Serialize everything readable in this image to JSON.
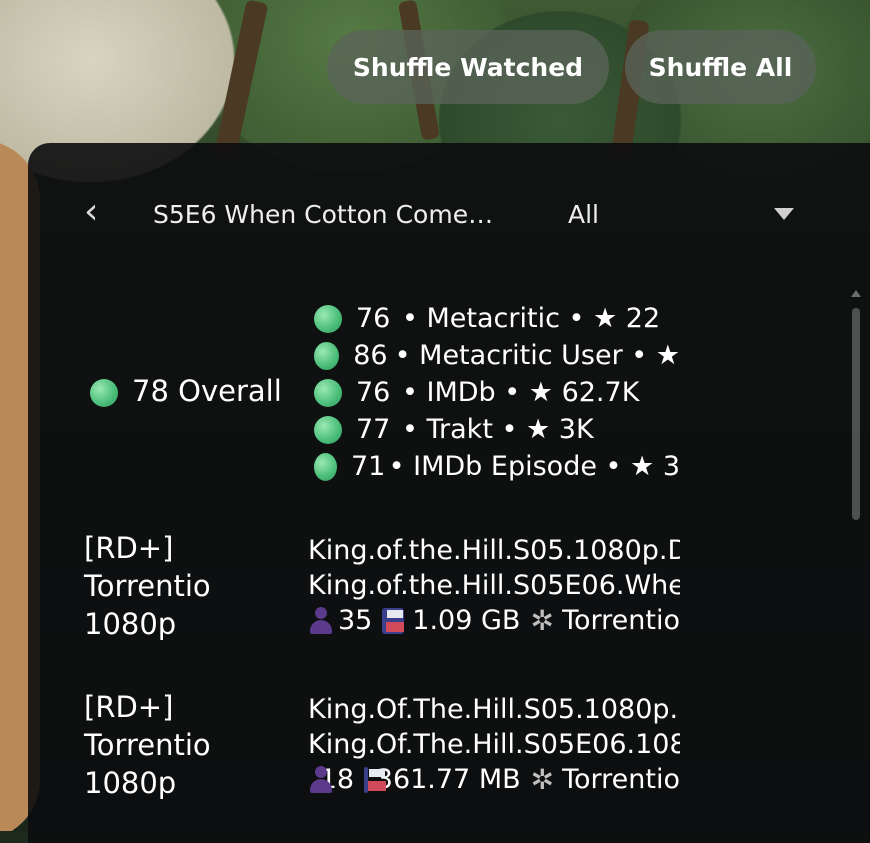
{
  "header": {
    "shuffle_watched": "Shuffle Watched",
    "shuffle_all": "Shuffle All"
  },
  "topbar": {
    "back_icon": "chevron-left-icon",
    "episode_title": "S5E6 When Cotton Come…",
    "filter_value": "All",
    "dropdown_icon": "caret-down-icon"
  },
  "overall": {
    "score": "78",
    "label": "Overall"
  },
  "ratings": [
    {
      "score": "76",
      "text": "• Metacritic • ★ 22"
    },
    {
      "score": "86",
      "text": "• Metacritic User • ★"
    },
    {
      "score": "76",
      "text": "• IMDb • ★ 62.7K"
    },
    {
      "score": "77",
      "text": "• Trakt • ★ 3K"
    },
    {
      "score": "71",
      "text": "• IMDb Episode • ★ 3"
    }
  ],
  "streams": [
    {
      "label_line1": "[RD+]",
      "label_line2": "Torrentio",
      "label_line3": "1080p",
      "filename1": "King.of.the.Hill.S05.1080p.D",
      "filename2": "King.of.the.Hill.S05E06.Whe",
      "seeders": "35",
      "size": "1.09 GB",
      "source": "Torrentio"
    },
    {
      "label_line1": "[RD+]",
      "label_line2": "Torrentio",
      "label_line3": "1080p",
      "filename1": "King.Of.The.Hill.S05.1080p.",
      "filename2": "King.Of.The.Hill.S05E06.108",
      "seeders": "18",
      "size": "361.77 MB",
      "source": "Torrentio"
    }
  ],
  "colors": {
    "rating_dot": "#4ec07c",
    "panel_bg": "#0c0c0e",
    "pill_bg": "#5a6458"
  }
}
